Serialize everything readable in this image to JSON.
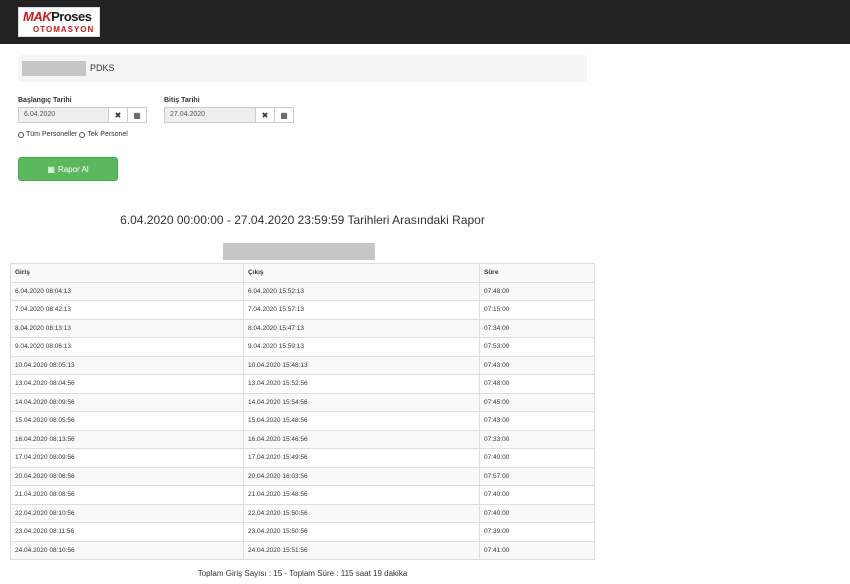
{
  "logo": {
    "mak": "MAK",
    "proses": "Proses",
    "bottom": "OTOMASYON"
  },
  "breadcrumb": {
    "label": "PDKS"
  },
  "filters": {
    "start_label": "Başlangıç Tarihi",
    "start_value": "6.04.2020",
    "end_label": "Bitiş Tarihi",
    "end_value": "27.04.2020",
    "clear_icon": "✖",
    "calendar_icon": "▦"
  },
  "radios": {
    "all_label": "Tüm Personeller",
    "single_label": "Tek Personel"
  },
  "actions": {
    "report_label": "Rapor Al",
    "report_icon": "▦"
  },
  "report": {
    "title": "6.04.2020 00:00:00 - 27.04.2020 23:59:59 Tarihleri Arasındaki Rapor"
  },
  "table": {
    "headers": [
      "Giriş",
      "Çıkış",
      "Süre"
    ],
    "rows": [
      [
        "6.04.2020 08:04:13",
        "6.04.2020 15:52:13",
        "07:48:00"
      ],
      [
        "7.04.2020 08:42:13",
        "7.04.2020 15:57:13",
        "07:15:00"
      ],
      [
        "8.04.2020 08:13:13",
        "8.04.2020 15:47:13",
        "07:34:00"
      ],
      [
        "9.04.2020 08:06:13",
        "9.04.2020 15:59:13",
        "07:53:00"
      ],
      [
        "10.04.2020 08:05:13",
        "10.04.2020 15:48:13",
        "07:43:00"
      ],
      [
        "13.04.2020 08:04:56",
        "13.04.2020 15:52:56",
        "07:48:00"
      ],
      [
        "14.04.2020 08:09:56",
        "14.04.2020 15:54:56",
        "07:45:00"
      ],
      [
        "15.04.2020 08:05:56",
        "15.04.2020 15:48:56",
        "07:43:00"
      ],
      [
        "16.04.2020 08:13:56",
        "16.04.2020 15:46:56",
        "07:33:00"
      ],
      [
        "17.04.2020 08:09:56",
        "17.04.2020 15:49:56",
        "07:40:00"
      ],
      [
        "20.04.2020 08:06:56",
        "20.04.2020 16:03:56",
        "07:57:00"
      ],
      [
        "21.04.2020 08:08:56",
        "21.04.2020 15:48:56",
        "07:40:00"
      ],
      [
        "22.04.2020 08:10:56",
        "22.04.2020 15:50:56",
        "07:40:00"
      ],
      [
        "23.04.2020 08:11:56",
        "23.04.2020 15:50:56",
        "07:39:00"
      ],
      [
        "24.04.2020 08:10:56",
        "24.04.2020 15:51:56",
        "07:41:00"
      ]
    ]
  },
  "summary": "Toplam Giriş Sayısı : 15 - Toplam Süre : 115 saat 19 dakika",
  "colors": {
    "topbar": "#222222",
    "brand_red": "#d01818",
    "success": "#5cb85c"
  }
}
